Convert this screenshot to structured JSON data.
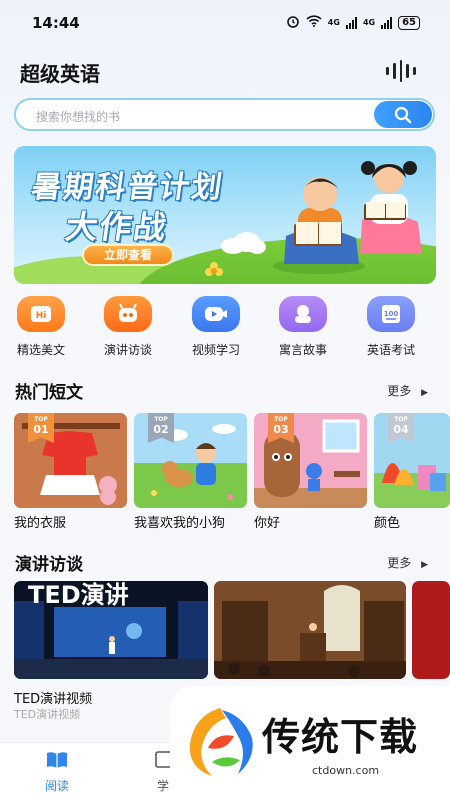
{
  "status": {
    "time": "14:44",
    "net1": "4G",
    "net2": "4G",
    "battery": "65"
  },
  "header": {
    "title": "超级英语"
  },
  "search": {
    "placeholder": "搜索你想找的书"
  },
  "banner": {
    "title_line1": "暑期科普计划",
    "title_line2": "大作战",
    "button": "立即查看"
  },
  "categories": [
    {
      "label": "精选美文",
      "icon": "article-icon",
      "color": "#ff8a2a"
    },
    {
      "label": "演讲访谈",
      "icon": "robot-speech-icon",
      "color": "#ff7a2a"
    },
    {
      "label": "视频学习",
      "icon": "video-icon",
      "color": "#4a86f7"
    },
    {
      "label": "寓言故事",
      "icon": "story-character-icon",
      "color": "#a57af3"
    },
    {
      "label": "英语考试",
      "icon": "exam-100-icon",
      "color": "#6f86f5"
    }
  ],
  "hot": {
    "title": "热门短文",
    "more": "更多",
    "items": [
      {
        "rank_label": "TOP",
        "rank": "01",
        "title": "我的衣服"
      },
      {
        "rank_label": "TOP",
        "rank": "02",
        "title": "我喜欢我的小狗"
      },
      {
        "rank_label": "TOP",
        "rank": "03",
        "title": "你好"
      },
      {
        "rank_label": "TOP",
        "rank": "04",
        "title": "颜色"
      }
    ]
  },
  "talks": {
    "title": "演讲访谈",
    "more": "更多",
    "items": [
      {
        "image_text": "TED演讲",
        "title": "TED演讲视频",
        "subtitle": "TED演讲视频"
      }
    ]
  },
  "tabs": [
    {
      "label": "阅读",
      "active": true
    },
    {
      "label": "学",
      "active": false
    }
  ],
  "watermark": {
    "brand": "传统下载",
    "url": "ctdown.com"
  }
}
